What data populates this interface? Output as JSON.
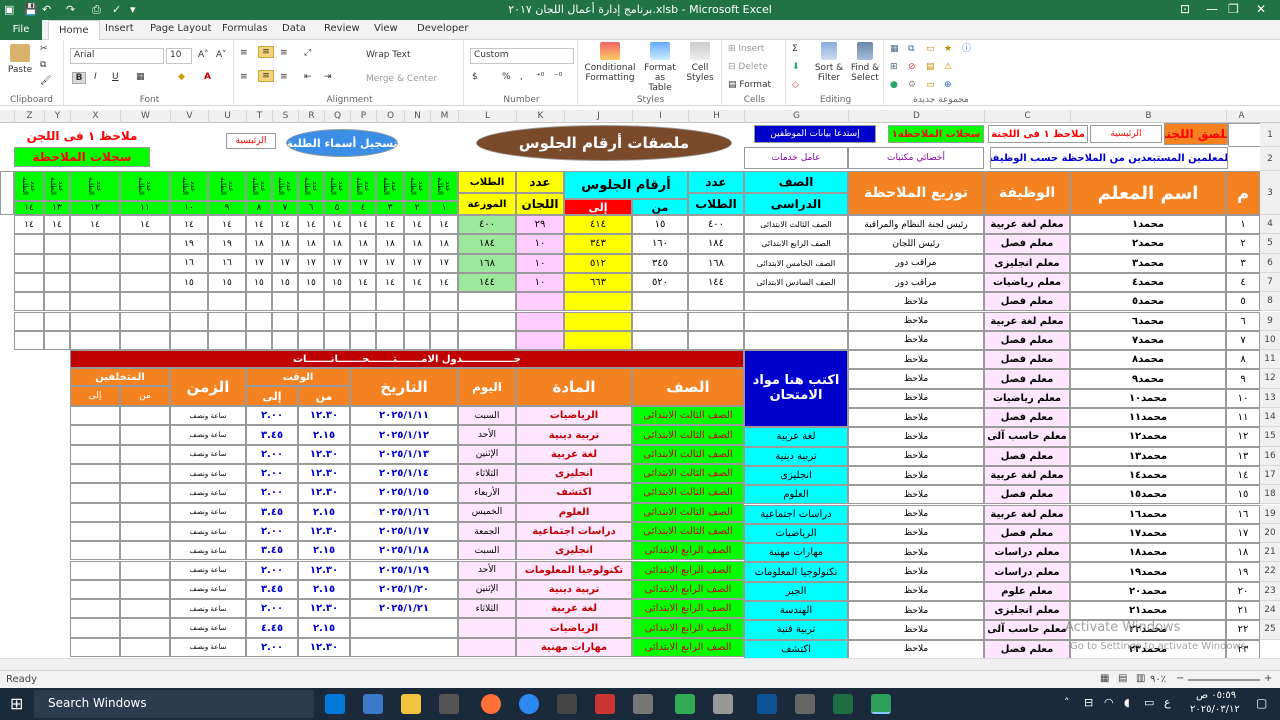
{
  "window": {
    "title": "برنامج إدارة أعمال اللجان ٢٠١٧.xlsb - Microsoft Excel",
    "minimize_glyph": "—",
    "restore_glyph": "❐",
    "close_glyph": "✕",
    "options_glyph": "⊡"
  },
  "tabs": [
    "File",
    "Home",
    "Insert",
    "Page Layout",
    "Formulas",
    "Data",
    "Review",
    "View",
    "Developer"
  ],
  "ribbon": {
    "paste": "Paste",
    "font_name": "Arial",
    "font_size": "10",
    "wrap_text": "Wrap Text",
    "merge_center": "Merge & Center",
    "number_format": "Custom",
    "cond_formatting": "Conditional Formatting",
    "format_table": "Format as Table",
    "cell_styles": "Cell Styles",
    "insert": "Insert",
    "delete": "Delete",
    "format": "Format",
    "sort_filter": "Sort & Filter",
    "find_select": "Find & Select",
    "groups": {
      "clipboard": "Clipboard",
      "font": "Font",
      "alignment": "Alignment",
      "number": "Number",
      "styles": "Styles",
      "cells": "Cells",
      "editing": "Editing",
      "new_group": "مجموعة جديدة"
    },
    "bold": "B",
    "italic": "I",
    "underline": "U",
    "percent": "%",
    "comma": ","
  },
  "columns": [
    "Z",
    "Y",
    "X",
    "W",
    "V",
    "U",
    "T",
    "S",
    "R",
    "Q",
    "P",
    "O",
    "N",
    "M",
    "L",
    "K",
    "J",
    "I",
    "H",
    "G",
    "F",
    "E",
    "D",
    "C",
    "B",
    "A"
  ],
  "sheet": {
    "A1": "ملصق اللجنة",
    "B1_btn": "الرئيسية",
    "C1_btn": "ملاحظ ١ فى اللجنة",
    "D1_btn": "سجلات الملاحظة١",
    "E1_btn": "إستدعا بيانات الموظفين",
    "banner": "ملصقات أرقام الجلوس",
    "register_btn": "تسجيل أسماء الطلبة",
    "home_btn2": "الرئيسية",
    "left_title1": "ملاحظ ١ فى اللجن",
    "left_title2": "سجلات الملاحظة",
    "row2_info": "المعلمين المستبعدين من الملاحظة حسب الوظيفة",
    "row2_d": "أخصائي مكتبات",
    "row2_e": "عامل خدمات",
    "hdr_m": "م",
    "hdr_name": "اسم المعلم",
    "hdr_job": "الوظيفة",
    "hdr_dist": "توزيع الملاحظة",
    "hdr_class": "الصف",
    "hdr_class2": "الدراسى",
    "hdr_count": "عدد",
    "hdr_students": "الطلاب",
    "hdr_seats": "أرقام الجلوس",
    "hdr_from": "من",
    "hdr_to": "إلى",
    "hdr_lj": "عدد",
    "hdr_lj2": "اللجان",
    "hdr_st": "الطلاب",
    "hdr_st2": "الموزعة",
    "committee_hdr": "عدد الطلبة",
    "committee_nums": [
      "١",
      "٢",
      "٣",
      "٤",
      "٥",
      "٦",
      "٧",
      "٨",
      "٩",
      "١٠",
      "١١",
      "١٢",
      "١٣",
      "١٤"
    ],
    "teachers": [
      {
        "n": "١",
        "name": "محمد١",
        "job": "معلم لغة عربية",
        "dist": "رئيس لجنة النظام والمراقبة"
      },
      {
        "n": "٢",
        "name": "محمد٢",
        "job": "معلم فصل",
        "dist": "رئيس اللجان"
      },
      {
        "n": "٣",
        "name": "محمد٣",
        "job": "معلم انجليزى",
        "dist": "مراقب دور"
      },
      {
        "n": "٤",
        "name": "محمد٤",
        "job": "معلم رياضيات",
        "dist": "مراقب دور"
      },
      {
        "n": "٥",
        "name": "محمد٥",
        "job": "معلم فصل",
        "dist": "ملاحظ"
      },
      {
        "n": "٦",
        "name": "محمد٦",
        "job": "معلم لغة عربية",
        "dist": "ملاحظ"
      },
      {
        "n": "٧",
        "name": "محمد٧",
        "job": "معلم فصل",
        "dist": "ملاحظ"
      },
      {
        "n": "٨",
        "name": "محمد٨",
        "job": "معلم فصل",
        "dist": "ملاحظ"
      },
      {
        "n": "٩",
        "name": "محمد٩",
        "job": "معلم فصل",
        "dist": "ملاحظ"
      },
      {
        "n": "١٠",
        "name": "محمد١٠",
        "job": "معلم رياضيات",
        "dist": "ملاحظ"
      },
      {
        "n": "١١",
        "name": "محمد١١",
        "job": "معلم فصل",
        "dist": "ملاحظ"
      },
      {
        "n": "١٢",
        "name": "محمد١٢",
        "job": "معلم حاسب آلى",
        "dist": "ملاحظ"
      },
      {
        "n": "١٣",
        "name": "محمد١٣",
        "job": "معلم فصل",
        "dist": "ملاحظ"
      },
      {
        "n": "١٤",
        "name": "محمد١٤",
        "job": "معلم لغة عربية",
        "dist": "ملاحظ"
      },
      {
        "n": "١٥",
        "name": "محمد١٥",
        "job": "معلم فصل",
        "dist": "ملاحظ"
      },
      {
        "n": "١٦",
        "name": "محمد١٦",
        "job": "معلم لغة عربية",
        "dist": "ملاحظ"
      },
      {
        "n": "١٧",
        "name": "محمد١٧",
        "job": "معلم فصل",
        "dist": "ملاحظ"
      },
      {
        "n": "١٨",
        "name": "محمد١٨",
        "job": "معلم دراسات",
        "dist": "ملاحظ"
      },
      {
        "n": "١٩",
        "name": "محمد١٩",
        "job": "معلم دراسات",
        "dist": "ملاحظ"
      },
      {
        "n": "٢٠",
        "name": "محمد٢٠",
        "job": "معلم علوم",
        "dist": "ملاحظ"
      },
      {
        "n": "٢١",
        "name": "محمد٢١",
        "job": "معلم انجليزى",
        "dist": "ملاحظ"
      },
      {
        "n": "٢٢",
        "name": "محمد٢٢",
        "job": "معلم حاسب آلى",
        "dist": "ملاحظ"
      },
      {
        "n": "٢٣",
        "name": "محمد٢٣",
        "job": "معلم فصل",
        "dist": "ملاحظ"
      }
    ],
    "classes": [
      {
        "cls": "الصف الثالث الابتدائى",
        "count": "٤٠٠",
        "from": "١٥",
        "to": "٤١٤",
        "lj": "٢٩",
        "st": "٤٠٠",
        "dist": [
          "١٤",
          "١٤",
          "١٤",
          "١٤",
          "١٤",
          "١٤",
          "١٤",
          "١٤",
          "١٤",
          "١٤",
          "١٤",
          "١٤",
          "١٤",
          "١٤"
        ]
      },
      {
        "cls": "الصف الرابع الابتدائى",
        "count": "١٨٤",
        "from": "١٦٠",
        "to": "٣٤٣",
        "lj": "١٠",
        "st": "١٨٤",
        "dist": [
          "١٨",
          "١٨",
          "١٨",
          "١٨",
          "١٨",
          "١٨",
          "١٨",
          "١٨",
          "١٩",
          "١٩",
          "",
          "",
          "",
          ""
        ]
      },
      {
        "cls": "الصف الخامس الابتدائى",
        "count": "١٦٨",
        "from": "٣٤٥",
        "to": "٥١٢",
        "lj": "١٠",
        "st": "١٦٨",
        "dist": [
          "١٧",
          "١٧",
          "١٧",
          "١٧",
          "١٧",
          "١٧",
          "١٧",
          "١٧",
          "١٦",
          "١٦",
          "",
          "",
          "",
          ""
        ]
      },
      {
        "cls": "الصف السادس الابتدائى",
        "count": "١٤٤",
        "from": "٥٢٠",
        "to": "٦٦٣",
        "lj": "١٠",
        "st": "١٤٤",
        "dist": [
          "١٤",
          "١٤",
          "١٤",
          "١٤",
          "١٥",
          "١٥",
          "١٥",
          "١٥",
          "١٥",
          "١٥",
          "",
          "",
          "",
          ""
        ]
      }
    ],
    "subjects_box": "اكتب هنا مواد الامتحان",
    "subjects_col": [
      "لغة عربية",
      "تربية دينية",
      "انجليزى",
      "العلوم",
      "دراسات اجتماعية",
      "الرياضيات",
      "مهارات مهنية",
      "تكنولوجيا المعلومات",
      "الجبر",
      "الهندسة",
      "تربية فنية",
      "اكتشف"
    ],
    "exam_title": "جـــــــــــــــدول الامـــــــتـــــــحـــــــانـــــــات",
    "exam_hdr": {
      "class": "الصف",
      "subject": "المادة",
      "day": "اليوم",
      "date": "التاريخ",
      "time": "الوقت",
      "from": "من",
      "to": "إلى",
      "duration": "الزمن",
      "absent": "المتخلفين",
      "afrom": "من",
      "ato": "إلى"
    },
    "exams": [
      {
        "cls": "الصف الثالث الابتدائى",
        "subj": "الرياضيات",
        "day": "السبت",
        "date": "٢٠٢٥/١/١١",
        "from": "١٢.٣٠",
        "to": "٢.٠٠",
        "dur": "ساعة ونصف"
      },
      {
        "cls": "الصف الثالث الابتدائى",
        "subj": "تربية دينية",
        "day": "الأحد",
        "date": "٢٠٢٥/١/١٢",
        "from": "٢.١٥",
        "to": "٣.٤٥",
        "dur": "ساعة ونصف"
      },
      {
        "cls": "الصف الثالث الابتدائى",
        "subj": "لغة عربية",
        "day": "الإثنين",
        "date": "٢٠٢٥/١/١٣",
        "from": "١٢.٣٠",
        "to": "٢.٠٠",
        "dur": "ساعة ونصف"
      },
      {
        "cls": "الصف الثالث الابتدائى",
        "subj": "انجليزى",
        "day": "الثلاثاء",
        "date": "٢٠٢٥/١/١٤",
        "from": "١٢.٣٠",
        "to": "٢.٠٠",
        "dur": "ساعة ونصف"
      },
      {
        "cls": "الصف الثالث الابتدائى",
        "subj": "اكتشف",
        "day": "الأربعاء",
        "date": "٢٠٢٥/١/١٥",
        "from": "١٢.٣٠",
        "to": "٢.٠٠",
        "dur": "ساعة ونصف"
      },
      {
        "cls": "الصف الثالث الابتدائى",
        "subj": "العلوم",
        "day": "الخميس",
        "date": "٢٠٢٥/١/١٦",
        "from": "٢.١٥",
        "to": "٣.٤٥",
        "dur": "ساعة ونصف"
      },
      {
        "cls": "الصف الثالث الابتدائى",
        "subj": "دراسات اجتماعية",
        "day": "الجمعة",
        "date": "٢٠٢٥/١/١٧",
        "from": "١٢.٣٠",
        "to": "٢.٠٠",
        "dur": "ساعة ونصف"
      },
      {
        "cls": "الصف الرابع الابتدائى",
        "subj": "انجليزى",
        "day": "السبت",
        "date": "٢٠٢٥/١/١٨",
        "from": "٢.١٥",
        "to": "٣.٤٥",
        "dur": "ساعة ونصف"
      },
      {
        "cls": "الصف الرابع الابتدائى",
        "subj": "تكنولوجيا المعلومات",
        "day": "الأحد",
        "date": "٢٠٢٥/١/١٩",
        "from": "١٢.٣٠",
        "to": "٢.٠٠",
        "dur": "ساعة ونصف"
      },
      {
        "cls": "الصف الرابع الابتدائى",
        "subj": "تربية دينية",
        "day": "الإثنين",
        "date": "٢٠٢٥/١/٢٠",
        "from": "٢.١٥",
        "to": "٣.٤٥",
        "dur": "ساعة ونصف"
      },
      {
        "cls": "الصف الرابع الابتدائى",
        "subj": "لغة عربية",
        "day": "الثلاثاء",
        "date": "٢٠٢٥/١/٢١",
        "from": "١٢.٣٠",
        "to": "٢.٠٠",
        "dur": "ساعة ونصف"
      },
      {
        "cls": "الصف الرابع الابتدائى",
        "subj": "الرياضيات",
        "day": "",
        "date": "",
        "from": "٢.١٥",
        "to": "٤.٤٥",
        "dur": "ساعة ونصف"
      },
      {
        "cls": "الصف الرابع الابتدائى",
        "subj": "مهارات مهنية",
        "day": "",
        "date": "",
        "from": "١٢.٣٠",
        "to": "٢.٠٠",
        "dur": "ساعة ونصف"
      }
    ]
  },
  "status": {
    "ready": "Ready",
    "zoom": "٩٠٪"
  },
  "watermark": {
    "line1": "Activate Windows",
    "line2": "Go to Settings to activate Windows."
  },
  "taskbar": {
    "search": "Search Windows",
    "time": "٠٥:٥٩ ص",
    "date": "٢٠٢٥/٠٣/١٢",
    "lang": "ع"
  },
  "colors": {
    "excel_green": "#217346",
    "magenta": "#ff00ff",
    "green": "#00ff00",
    "orange": "#f58220",
    "cyan": "#00ffff",
    "yellow": "#ffff00",
    "blue": "#0000cc",
    "red": "#ff0000",
    "pink": "#ffccff",
    "lightgreen": "#9de89d"
  }
}
